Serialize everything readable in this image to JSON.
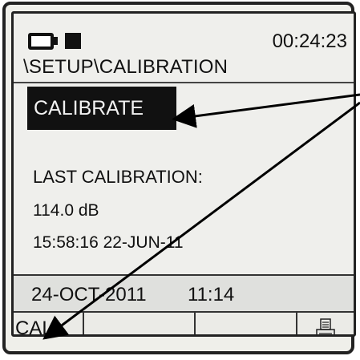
{
  "status_bar": {
    "battery_icon": "battery-icon",
    "indicator_icon": "status-square-icon",
    "time": "00:24:23"
  },
  "breadcrumb": "\\SETUP\\CALIBRATION",
  "actions": {
    "calibrate_label": "CALIBRATE"
  },
  "last_calibration": {
    "title": "LAST CALIBRATION:",
    "level": "114.0 dB",
    "timestamp": "15:58:16  22-JUN-11"
  },
  "footer": {
    "date": "24-OCT-2011",
    "time": "11:14"
  },
  "softkeys": {
    "key1_label": "CAL",
    "key4_icon": "printer-icon"
  },
  "colors": {
    "highlight_bg": "#111111",
    "highlight_text": "#f2f2f2",
    "screen_bg": "#efefec"
  }
}
